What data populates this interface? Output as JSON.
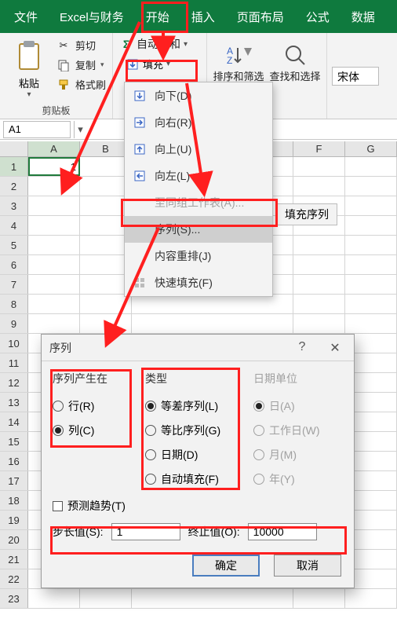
{
  "tabs": {
    "file": "文件",
    "excel_finance": "Excel与财务",
    "start": "开始",
    "insert": "插入",
    "layout": "页面布局",
    "formula": "公式",
    "data": "数据"
  },
  "ribbon": {
    "paste": "粘贴",
    "cut": "剪切",
    "copy": "复制",
    "format_painter": "格式刷",
    "clipboard_group": "剪贴板",
    "autosum": "自动求和",
    "fill": "填充",
    "sort_filter": "排序和筛选",
    "find_select": "查找和选择",
    "font_family": "宋体"
  },
  "namebox": {
    "value": "A1"
  },
  "columns": [
    "A",
    "B",
    "F",
    "G"
  ],
  "rows": [
    "1",
    "2",
    "3",
    "4",
    "5",
    "6",
    "7",
    "8",
    "9",
    "10",
    "11",
    "12",
    "13",
    "14",
    "15",
    "16",
    "17",
    "18",
    "19",
    "20",
    "21",
    "22",
    "23"
  ],
  "cell_A1": "1",
  "fill_menu": {
    "down": "向下(D)",
    "right": "向右(R)",
    "up": "向上(U)",
    "left": "向左(L)",
    "across": "至同组工作表(A)...",
    "series": "序列(S)...",
    "justify": "内容重排(J)",
    "flash": "快速填充(F)"
  },
  "ext_badge": "填充序列",
  "dialog": {
    "title": "序列",
    "group_in": "序列产生在",
    "row": "行(R)",
    "col": "列(C)",
    "group_type": "类型",
    "linear": "等差序列(L)",
    "growth": "等比序列(G)",
    "date": "日期(D)",
    "autofill": "自动填充(F)",
    "group_dateunit": "日期单位",
    "day": "日(A)",
    "weekday": "工作日(W)",
    "month": "月(M)",
    "year": "年(Y)",
    "trend": "预测趋势(T)",
    "step_label": "步长值(S):",
    "step_value": "1",
    "stop_label": "终止值(O):",
    "stop_value": "10000",
    "ok": "确定",
    "cancel": "取消"
  }
}
